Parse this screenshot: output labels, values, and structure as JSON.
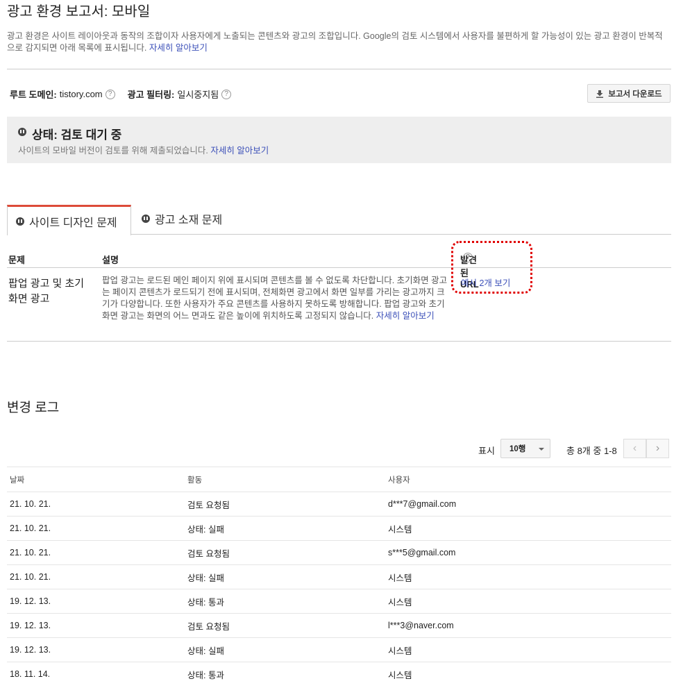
{
  "page": {
    "title": "광고 환경 보고서: 모바일",
    "intro": "광고 환경은 사이트 레이아웃과 동작의 조합이자 사용자에게 노출되는 콘텐츠와 광고의 조합입니다. Google의 검토 시스템에서 사용자를 불편하게 할 가능성이 있는 광고 환경이 반복적으로 감지되면 아래 목록에 표시됩니다.",
    "intro_link": "자세히 알아보기"
  },
  "meta": {
    "root_domain_label": "루트 도메인:",
    "root_domain_value": "tistory.com",
    "ad_filtering_label": "광고 필터링:",
    "ad_filtering_value": "일시중지됨",
    "help_glyph": "?",
    "download_button": "보고서 다운로드"
  },
  "status": {
    "title": "상태: 검토 대기 중",
    "subtitle": "사이트의 모바일 버전이 검토를 위해 제출되었습니다.",
    "link": "자세히 알아보기"
  },
  "tabs": [
    {
      "label": "사이트 디자인 문제",
      "active": true
    },
    {
      "label": "광고 소재 문제",
      "active": false
    }
  ],
  "issues": {
    "headers": {
      "problem": "문제",
      "description": "설명",
      "urls": "발견된 URL"
    },
    "rows": [
      {
        "problem": "팝업 광고 및 초기화면 광고",
        "description": "팝업 광고는 로드된 메인 페이지 위에 표시되며 콘텐츠를 볼 수 없도록 차단합니다. 초기화면 광고는 페이지 콘텐츠가 로드되기 전에 표시되며, 전체화면 광고에서 화면 일부를 가리는 광고까지 크기가 다양합니다. 또한 사용자가 주요 콘텐츠를 사용하지 못하도록 방해합니다. 팝업 광고와 초기화면 광고는 화면의 어느 면과도 같은 높이에 위치하도록 고정되지 않습니다.",
        "description_link": "자세히 알아보기",
        "urls_link": "예시 2개 보기"
      }
    ]
  },
  "changelog": {
    "title": "변경 로그",
    "show_label": "표시",
    "rows_per_page": "10행",
    "range": "총 8개 중 1-8",
    "prev_glyph": "‹",
    "next_glyph": "›",
    "headers": {
      "date": "날짜",
      "activity": "활동",
      "user": "사용자"
    },
    "rows": [
      {
        "date": "21. 10. 21.",
        "activity": "검토 요청됨",
        "user": "d***7@gmail.com"
      },
      {
        "date": "21. 10. 21.",
        "activity": "상태: 실패",
        "user": "시스템"
      },
      {
        "date": "21. 10. 21.",
        "activity": "검토 요청됨",
        "user": "s***5@gmail.com"
      },
      {
        "date": "21. 10. 21.",
        "activity": "상태: 실패",
        "user": "시스템"
      },
      {
        "date": "19. 12. 13.",
        "activity": "상태: 통과",
        "user": "시스템"
      },
      {
        "date": "19. 12. 13.",
        "activity": "검토 요청됨",
        "user": "l***3@naver.com"
      },
      {
        "date": "19. 12. 13.",
        "activity": "상태: 실패",
        "user": "시스템"
      },
      {
        "date": "18. 11. 14.",
        "activity": "상태: 통과",
        "user": "시스템"
      }
    ]
  },
  "colors": {
    "link": "#3b4fb8",
    "active_tab_accent": "#dd4b39",
    "highlight_annotation": "#e00000"
  }
}
